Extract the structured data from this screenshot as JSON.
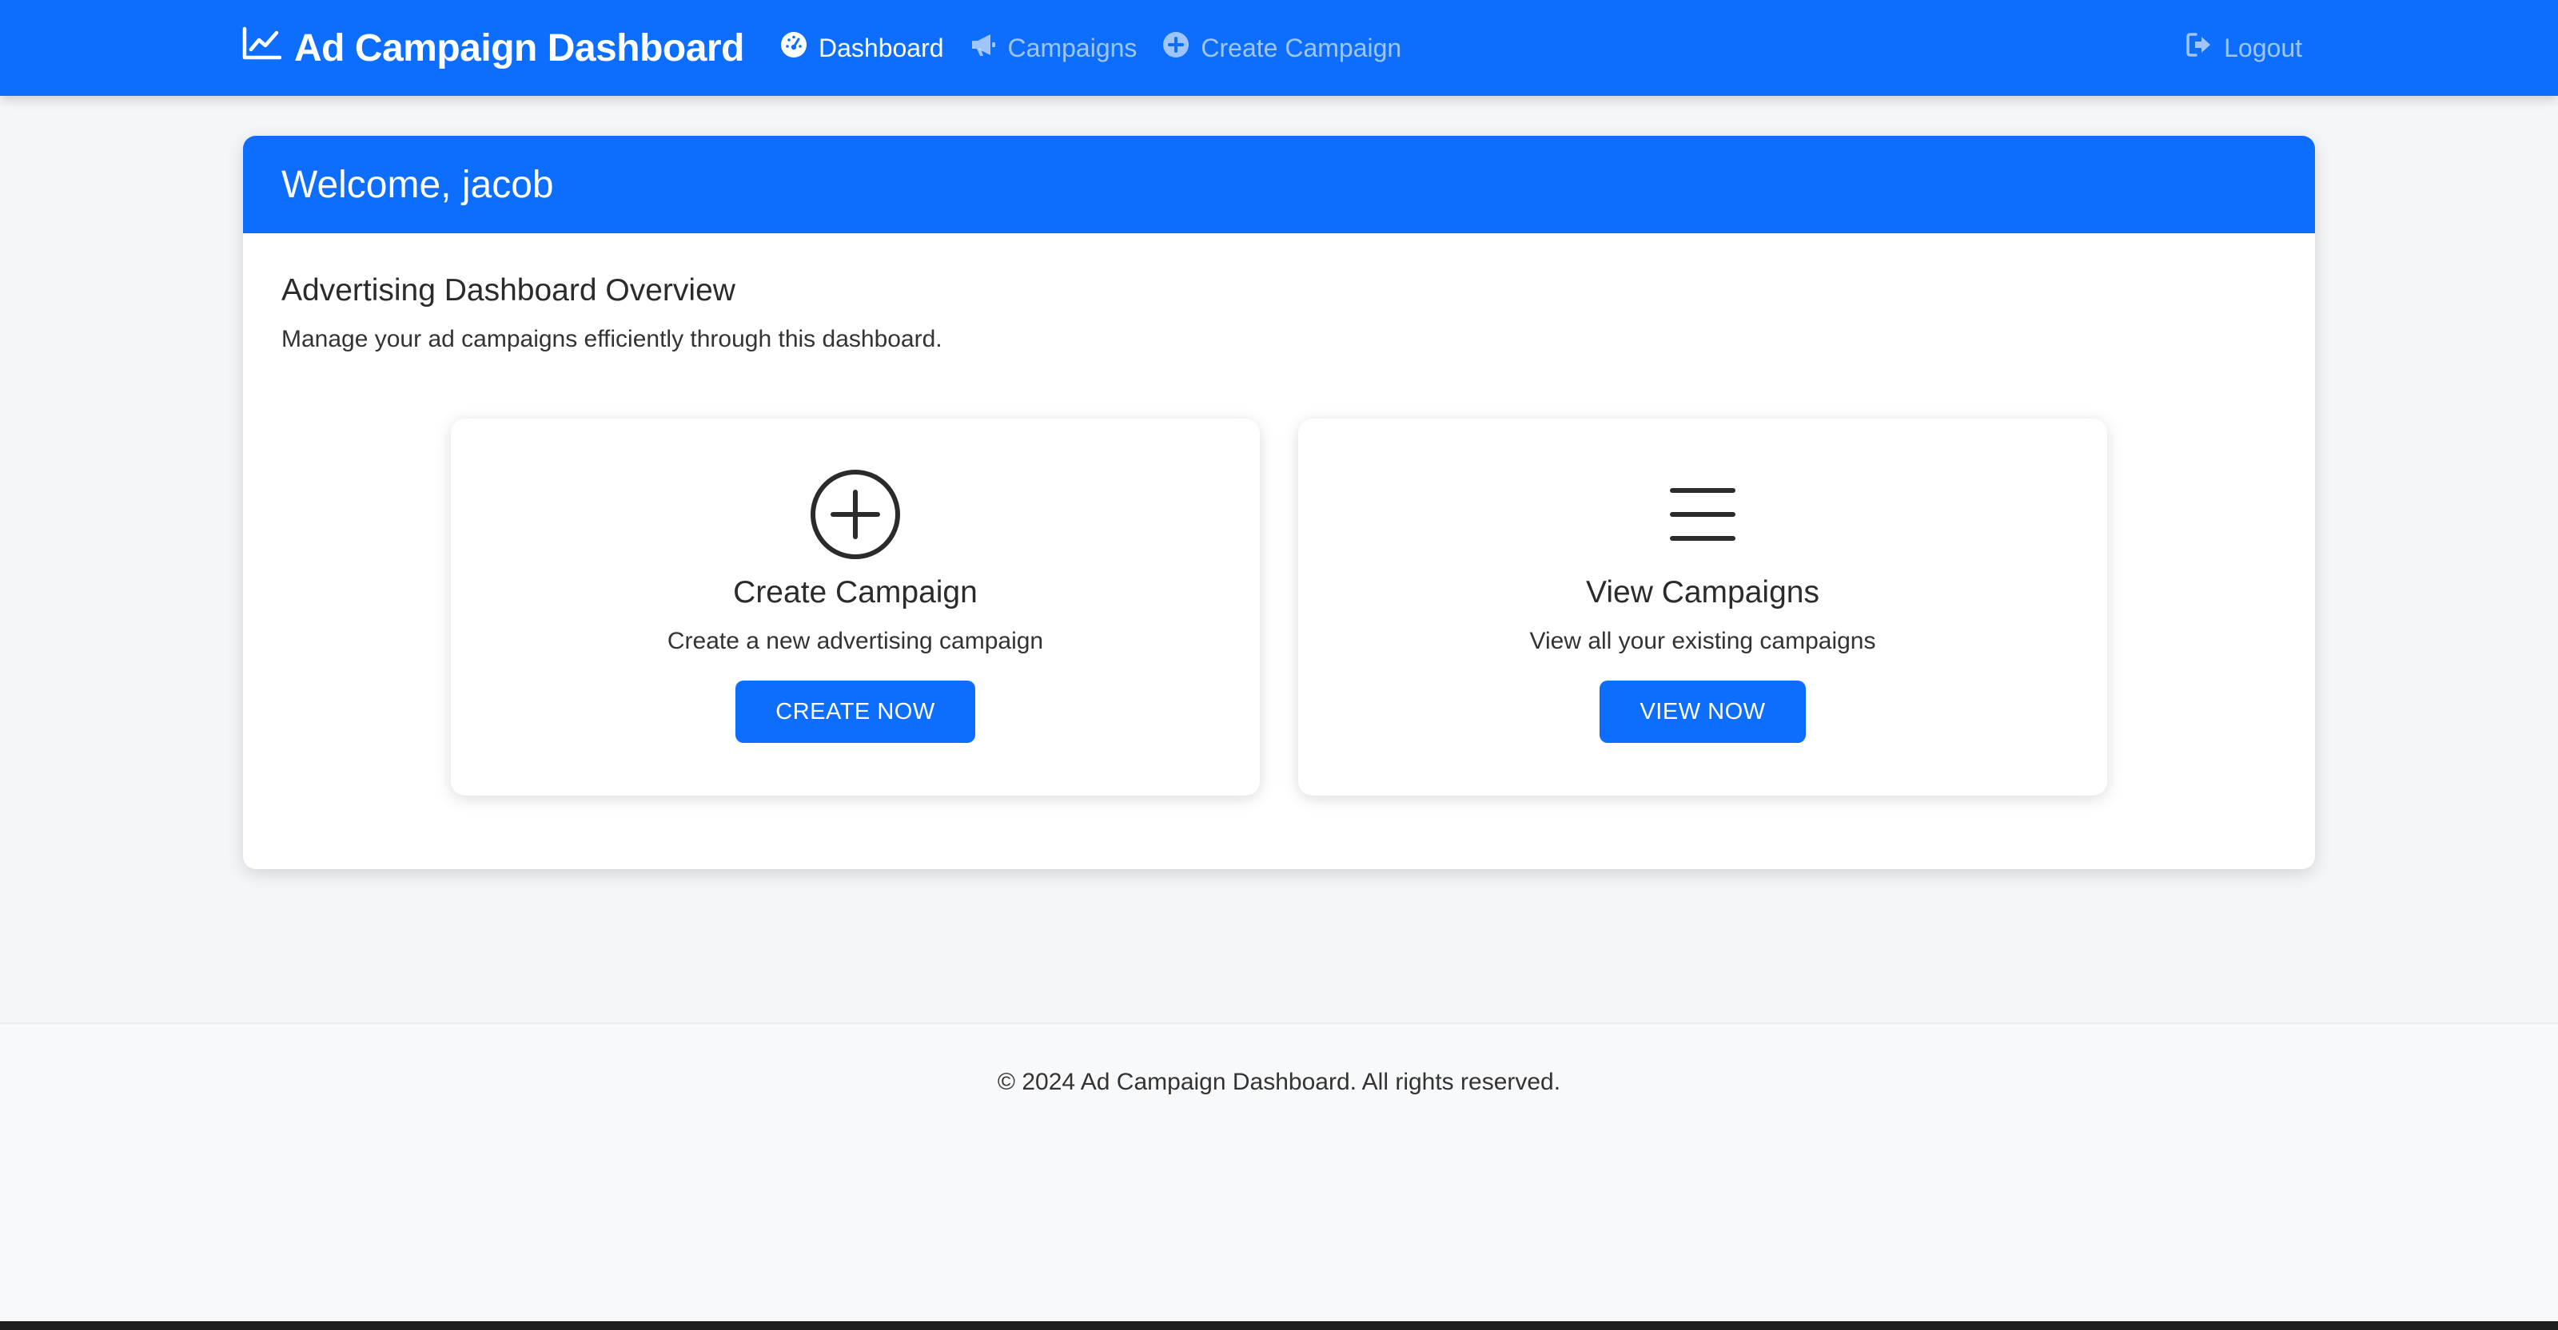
{
  "navbar": {
    "brand": "Ad Campaign Dashboard",
    "brand_icon": "chart-line-icon",
    "links": [
      {
        "label": "Dashboard",
        "icon": "gauge-icon",
        "active": true
      },
      {
        "label": "Campaigns",
        "icon": "bullhorn-icon",
        "active": false
      },
      {
        "label": "Create Campaign",
        "icon": "plus-circle-icon",
        "active": false
      }
    ],
    "logout": {
      "label": "Logout",
      "icon": "sign-out-icon"
    }
  },
  "main": {
    "header": "Welcome, jacob",
    "title": "Advertising Dashboard Overview",
    "description": "Manage your ad campaigns efficiently through this dashboard.",
    "cards": [
      {
        "icon": "plus-circle-icon",
        "title": "Create Campaign",
        "text": "Create a new advertising campaign",
        "button": "CREATE NOW"
      },
      {
        "icon": "list-icon",
        "title": "View Campaigns",
        "text": "View all your existing campaigns",
        "button": "VIEW NOW"
      }
    ]
  },
  "footer": {
    "text": "© 2024 Ad Campaign Dashboard. All rights reserved."
  },
  "colors": {
    "primary": "#0d6efd",
    "background": "#f4f6f9",
    "card": "#ffffff",
    "text": "#212529"
  }
}
